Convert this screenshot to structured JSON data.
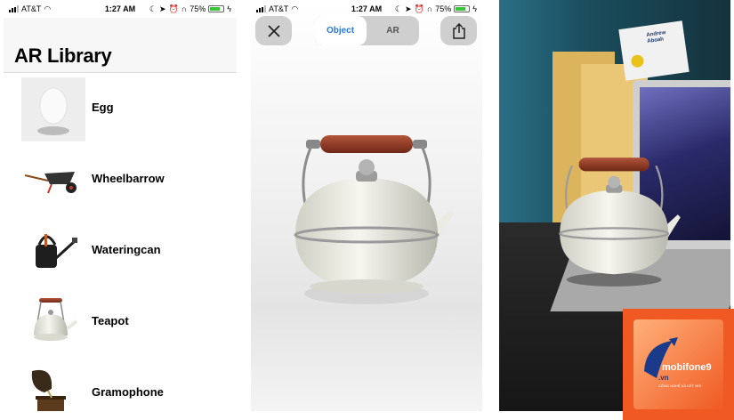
{
  "status_bar": {
    "carrier": "AT&T",
    "time": "1:27 AM",
    "battery": "75%",
    "battery_level": 0.75
  },
  "library": {
    "title": "AR Library",
    "items": [
      {
        "label": "Egg",
        "icon": "egg-icon"
      },
      {
        "label": "Wheelbarrow",
        "icon": "wheelbarrow-icon"
      },
      {
        "label": "Wateringcan",
        "icon": "watering-can-icon"
      },
      {
        "label": "Teapot",
        "icon": "teapot-icon"
      },
      {
        "label": "Gramophone",
        "icon": "gramophone-icon"
      }
    ]
  },
  "viewer": {
    "close_icon": "close-icon",
    "share_icon": "share-icon",
    "segments": [
      "Object",
      "AR"
    ],
    "selected_segment": "Object",
    "accent_color": "#2b7bd6"
  },
  "ar_scene": {
    "card_name": "Andrew Aboah"
  },
  "watermark": {
    "brand": "mobifone9",
    "domain": ".vn",
    "tagline": "CÔNG NGHỆ VÀ KẾT NỐI",
    "color": "#f05a22"
  }
}
